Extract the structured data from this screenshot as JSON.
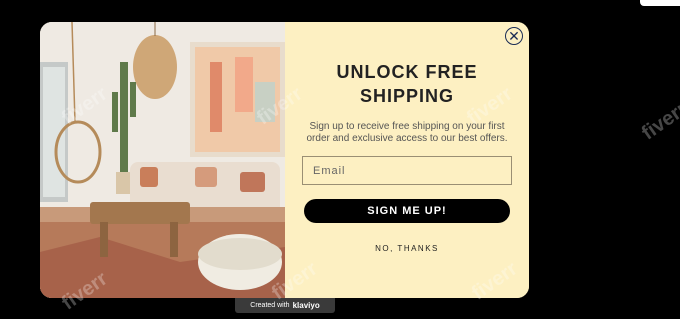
{
  "popup": {
    "title_line1": "UNLOCK FREE",
    "title_line2": "SHIPPING",
    "subtitle": "Sign up to receive free shipping on your first order and exclusive access to our best offers.",
    "email_placeholder": "Email",
    "cta_label": "SIGN ME UP!",
    "decline_label": "NO, THANKS",
    "close_glyph": "✕"
  },
  "badge": {
    "prefix": "Created with",
    "brand": "klaviyo"
  },
  "watermark": "fiverr",
  "colors": {
    "panel": "#fdf0c2",
    "cta": "#000000",
    "close": "#1a2c55"
  }
}
